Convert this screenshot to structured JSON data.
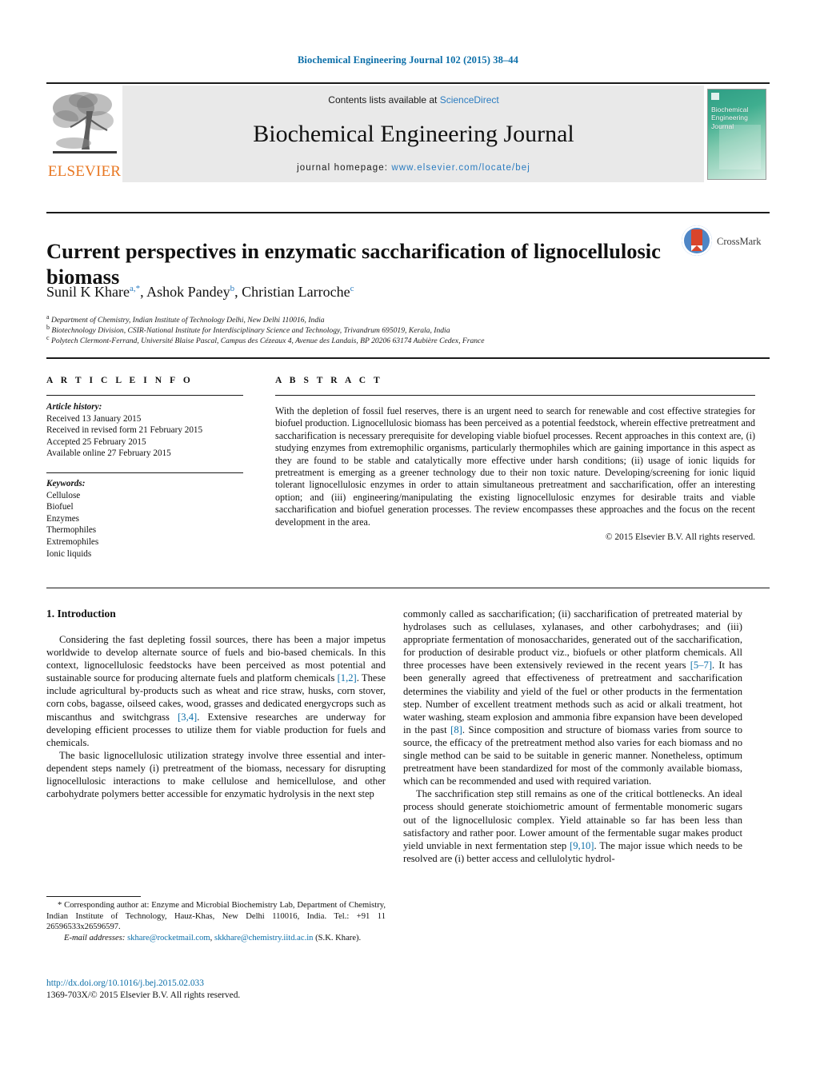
{
  "running_head": "Biochemical Engineering Journal 102 (2015) 38–44",
  "masthead": {
    "contents_prefix": "Contents lists available at ",
    "sciencedirect": "ScienceDirect",
    "journal_title": "Biochemical Engineering Journal",
    "homepage_prefix": "journal homepage: ",
    "homepage_url": "www.elsevier.com/locate/bej",
    "publisher": "ELSEVIER",
    "cover_title": "Biochemical Engineering Journal",
    "accent_color": "#2b7cc0",
    "publisher_color": "#e87722",
    "cover_color": "#3fae8f"
  },
  "article": {
    "title": "Current perspectives in enzymatic saccharification of lignocellulosic biomass",
    "crossmark_label": "CrossMark",
    "authors_html": "Sunil K Khare<sup>a,*</sup>, Ashok Pandey<sup>b</sup>, Christian Larroche<sup>c</sup>",
    "affiliations": [
      "Department of Chemistry, Indian Institute of Technology Delhi, New Delhi 110016, India",
      "Biotechnology Division, CSIR-National Institute for Interdisciplinary Science and Technology, Trivandrum 695019, Kerala, India",
      "Polytech Clermont-Ferrand, Université Blaise Pascal, Campus des Cézeaux 4, Avenue des Landais, BP 20206 63174 Aubière Cedex, France"
    ],
    "affiliation_marks": [
      "a",
      "b",
      "c"
    ]
  },
  "article_info": {
    "heading": "A R T I C L E   I N F O",
    "history_label": "Article history:",
    "history": [
      "Received 13 January 2015",
      "Received in revised form 21 February 2015",
      "Accepted 25 February 2015",
      "Available online 27 February 2015"
    ],
    "keywords_label": "Keywords:",
    "keywords": [
      "Cellulose",
      "Biofuel",
      "Enzymes",
      "Thermophiles",
      "Extremophiles",
      "Ionic liquids"
    ]
  },
  "abstract": {
    "heading": "A B S T R A C T",
    "text": "With the depletion of fossil fuel reserves, there is an urgent need to search for renewable and cost effective strategies for biofuel production. Lignocellulosic biomass has been perceived as a potential feedstock, wherein effective pretreatment and saccharification is necessary prerequisite for developing viable biofuel processes. Recent approaches in this context are, (i) studying enzymes from extremophilic organisms, particularly thermophiles which are gaining importance in this aspect as they are found to be stable and catalytically more effective under harsh conditions; (ii) usage of ionic liquids for pretreatment is emerging as a greener technology due to their non toxic nature. Developing/screening for ionic liquid tolerant lignocellulosic enzymes in order to attain simultaneous pretreatment and saccharification, offer an interesting option; and (iii) engineering/manipulating the existing lignocellulosic enzymes for desirable traits and viable saccharification and biofuel generation processes. The review encompasses these approaches and the focus on the recent development in the area.",
    "copyright": "© 2015 Elsevier B.V. All rights reserved."
  },
  "body": {
    "section_number_title": "1.  Introduction",
    "left_paragraph_1_a": "Considering the fast depleting fossil sources, there has been a major impetus worldwide to develop alternate source of fuels and bio-based chemicals. In this context, lignocellulosic feedstocks have been perceived as most potential and sustainable source for producing alternate fuels and platform chemicals ",
    "left_ref_1": "[1,2]",
    "left_paragraph_1_b": ". These include agricultural by-products such as wheat and rice straw, husks, corn stover, corn cobs, bagasse, oilseed cakes, wood, grasses and dedicated energycrops such as miscanthus and switchgrass ",
    "left_ref_2": "[3,4]",
    "left_paragraph_1_c": ". Extensive researches are underway for developing efficient processes to utilize them for viable production for fuels and chemicals.",
    "left_paragraph_2": "The basic lignocellulosic utilization strategy involve three essential and inter-dependent steps namely (i) pretreatment of the biomass, necessary for disrupting lignocellulosic interactions to make cellulose and hemicellulose, and other carbohydrate polymers better accessible for enzymatic hydrolysis in the next step",
    "right_paragraph_1_a": "commonly called as saccharification; (ii) saccharification of pretreated material by hydrolases such as cellulases, xylanases, and other carbohydrases; and (iii) appropriate fermentation of monosaccharides, generated out of the saccharification, for production of desirable product viz., biofuels or other platform chemicals. All three processes have been extensively reviewed in the recent years ",
    "right_ref_1": "[5–7]",
    "right_paragraph_1_b": ". It has been generally agreed that effectiveness of pretreatment and saccharification determines the viability and yield of the fuel or other products in the fermentation step. Number of excellent treatment methods such as acid or alkali treatment, hot water washing, steam explosion and ammonia fibre expansion have been developed in the past ",
    "right_ref_2": "[8]",
    "right_paragraph_1_c": ". Since composition and structure of biomass varies from source to source, the efficacy of the pretreatment method also varies for each biomass and no single method can be said to be suitable in generic manner. Nonetheless, optimum pretreatment have been standardized for most of the commonly available biomass, which can be recommended and used with required variation.",
    "right_paragraph_2_a": "The sacchrification step still remains as one of the critical bottlenecks. An ideal process should generate stoichiometric amount of fermentable monomeric sugars out of the lignocellulosic complex. Yield attainable so far has been less than satisfactory and rather poor. Lower amount of the fermentable sugar makes product yield unviable in next fermentation step ",
    "right_ref_3": "[9,10]",
    "right_paragraph_2_b": ". The major issue which needs to be resolved are (i) better access and cellulolytic hydrol-"
  },
  "footnote": {
    "corresponding_marker": "*",
    "corresponding_text": " Corresponding author at: Enzyme and Microbial Biochemistry Lab, Department of Chemistry, Indian Institute of Technology, Hauz-Khas, New Delhi 110016, India. Tel.: +91 11 26596533x26596597.",
    "email_label": "E-mail addresses:",
    "email_1": "skhare@rocketmail.com",
    "email_2": "skkhare@chemistry.iitd.ac.in",
    "email_owner": "(S.K. Khare).",
    "doi_url": "http://dx.doi.org/10.1016/j.bej.2015.02.033",
    "issn_line": "1369-703X/© 2015 Elsevier B.V. All rights reserved."
  }
}
